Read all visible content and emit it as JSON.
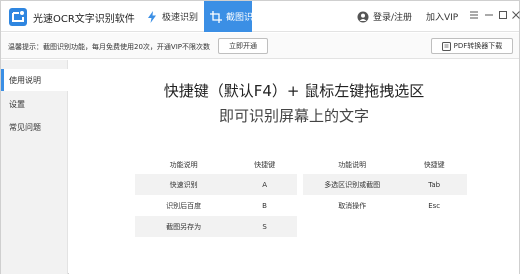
{
  "app": {
    "title": "光速OCR文字识别软件",
    "brand_color": "#3b8fe5"
  },
  "tabs": [
    {
      "label": "极速识别",
      "icon": "lightning-icon",
      "active": false
    },
    {
      "label": "截图识别",
      "icon": "screenshot-icon",
      "active": true
    }
  ],
  "header": {
    "login_label": "登录/注册",
    "vip_label": "加入VIP"
  },
  "notice": {
    "text": "温馨提示：截图识别功能，每月免费使用20次，开通VIP不限次数",
    "open_button": "立即开通",
    "pdf_button": "PDF转换器下载"
  },
  "sidebar": {
    "items": [
      {
        "label": "使用说明",
        "active": true
      },
      {
        "label": "设置",
        "active": false
      },
      {
        "label": "常见问题",
        "active": false
      }
    ]
  },
  "main": {
    "headline_1": "快捷键（默认F4）+ 鼠标左键拖拽选区",
    "headline_2": "即可识别屏幕上的文字",
    "left_table": {
      "headers": [
        "功能说明",
        "快捷键"
      ],
      "rows": [
        [
          "快速识别",
          "A"
        ],
        [
          "识别后百度",
          "B"
        ],
        [
          "截图另存为",
          "S"
        ]
      ]
    },
    "right_table": {
      "headers": [
        "功能说明",
        "快捷键"
      ],
      "rows": [
        [
          "多选区识别或截图",
          "Tab"
        ],
        [
          "取消操作",
          "Esc"
        ]
      ]
    }
  }
}
